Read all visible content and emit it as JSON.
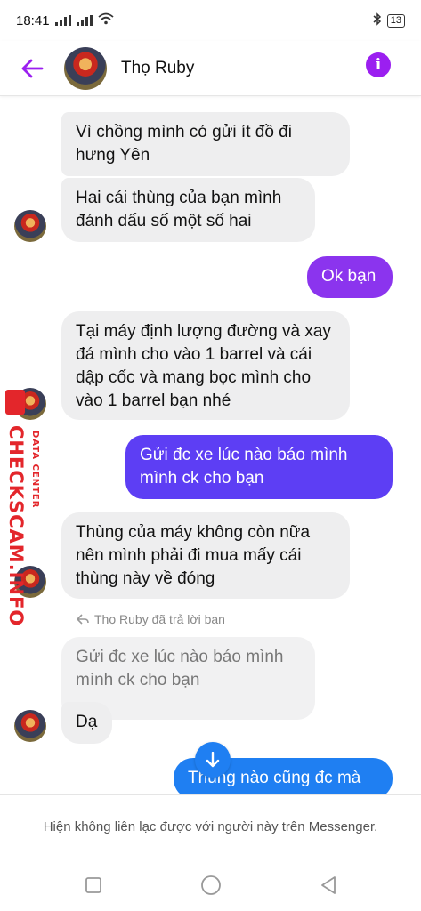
{
  "status_bar": {
    "time": "18:41",
    "battery": "13"
  },
  "header": {
    "contact_name": "Thọ Ruby"
  },
  "messages": [
    {
      "from": "them",
      "text": "Vì chồng mình có gửi ít đồ đi hưng Yên"
    },
    {
      "from": "them",
      "text": "Hai cái thùng của bạn mình đánh dấu số một số hai"
    },
    {
      "from": "me",
      "text": "Ok bạn"
    },
    {
      "from": "them",
      "text": "Tại máy định lượng đường và xay đá mình cho vào 1 barrel và cái dập cốc và mang bọc mình cho vào 1 barrel bạn nhé"
    },
    {
      "from": "me",
      "text": "Gửi đc xe lúc nào báo mình mình ck cho bạn"
    },
    {
      "from": "them",
      "text": "Thùng của máy không còn nữa nên mình phải đi mua mấy cái thùng này về đóng"
    },
    {
      "from": "them",
      "reply_label": "Thọ Ruby đã trả lời bạn",
      "quoted_text": "Gửi đc xe lúc nào báo mình mình ck cho bạn",
      "text": "Dạ"
    },
    {
      "from": "me",
      "text": "Thùng nào cũng đc mà"
    }
  ],
  "footer": {
    "notice": "Hiện không liên lạc được với người này trên Messenger."
  },
  "watermark": {
    "main": "CHECKSCAM.INFO",
    "sub": "DATA CENTER"
  },
  "colors": {
    "accent": "#9b1ff0",
    "sent_purple": "#8b34ee",
    "sent_blue": "#5d3ef4",
    "sent_azure": "#1f7ff2",
    "received_bg": "#eeeeef"
  }
}
